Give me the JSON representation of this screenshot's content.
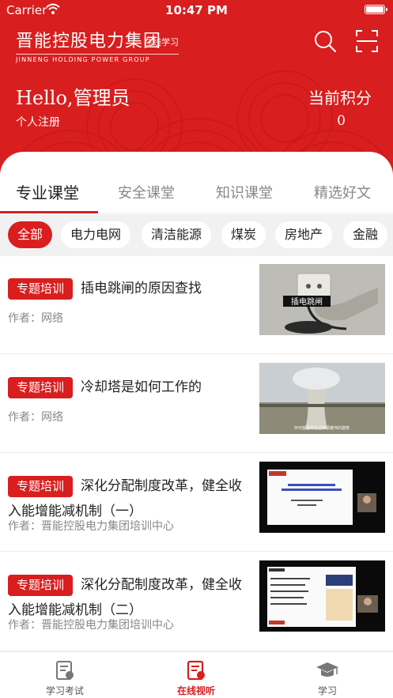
{
  "status_bar": {
    "carrier": "Carrier",
    "time": "10:47 PM"
  },
  "brand": {
    "name": "晋能控股电力集团",
    "english": "JINNENG HOLDING POWER GROUP",
    "slogan": "在线学习"
  },
  "user": {
    "greeting": "Hello,管理员",
    "register_label": "个人注册",
    "points_label": "当前积分",
    "points_value": "0"
  },
  "tabs": [
    {
      "label": "专业课堂",
      "active": true
    },
    {
      "label": "安全课堂",
      "active": false
    },
    {
      "label": "知识课堂",
      "active": false
    },
    {
      "label": "精选好文",
      "active": false
    }
  ],
  "categories": [
    {
      "label": "全部",
      "active": true
    },
    {
      "label": "电力电网",
      "active": false
    },
    {
      "label": "清洁能源",
      "active": false
    },
    {
      "label": "煤炭",
      "active": false
    },
    {
      "label": "房地产",
      "active": false
    },
    {
      "label": "金融",
      "active": false
    }
  ],
  "articles": [
    {
      "tag": "专题培训",
      "title": "插电跳闸的原因查找",
      "author": "作者：网络",
      "thumb_caption": "插电跳闸"
    },
    {
      "tag": "专题培训",
      "title": "冷却塔是如何工作的",
      "author": "作者：网络",
      "thumb_caption": "你可能看到过这种很雄伟的建筑"
    },
    {
      "tag": "专题培训",
      "title": "深化分配制度改革，健全收入能增能减机制（一）",
      "author": "作者：晋能控股电力集团培训中心",
      "thumb_caption": ""
    },
    {
      "tag": "专题培训",
      "title": "深化分配制度改革，健全收入能增能减机制（二）",
      "author": "作者：晋能控股电力集团培训中心",
      "thumb_caption": ""
    }
  ],
  "tabbar": [
    {
      "label": "学习考试",
      "active": false
    },
    {
      "label": "在线视听",
      "active": true
    },
    {
      "label": "学习",
      "active": false
    }
  ],
  "colors": {
    "brand_red": "#d81e1e",
    "chip_bg": "#f1f1f1"
  },
  "icons": [
    "wifi-icon",
    "battery-icon",
    "search-icon",
    "scan-icon",
    "exam-icon",
    "video-icon",
    "graduation-cap-icon"
  ]
}
